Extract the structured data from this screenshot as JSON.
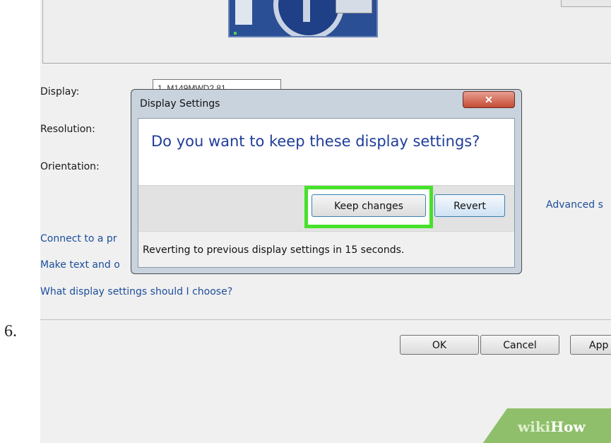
{
  "step": {
    "number": "6."
  },
  "screen_resolution": {
    "labels": {
      "display": "Display:",
      "resolution": "Resolution:",
      "orientation": "Orientation:"
    },
    "display_value": "1. M149MWD2 81",
    "advanced_link": "Advanced s",
    "links": {
      "connect_projector": "Connect to a pr",
      "make_text": "Make text and o",
      "which_settings": "What display settings should I choose?"
    },
    "buttons": {
      "ok": "OK",
      "cancel": "Cancel",
      "apply": "App"
    }
  },
  "dialog": {
    "title": "Display Settings",
    "close_glyph": "✕",
    "question": "Do you want to keep these display settings?",
    "keep_button": "Keep changes",
    "revert_button": "Revert",
    "countdown": "Reverting to previous display settings in 15 seconds."
  },
  "watermark": {
    "wiki": "wiki",
    "how": "How"
  },
  "colors": {
    "highlight": "#46e12a",
    "link": "#1c4e9b",
    "question": "#1f3d9a"
  }
}
